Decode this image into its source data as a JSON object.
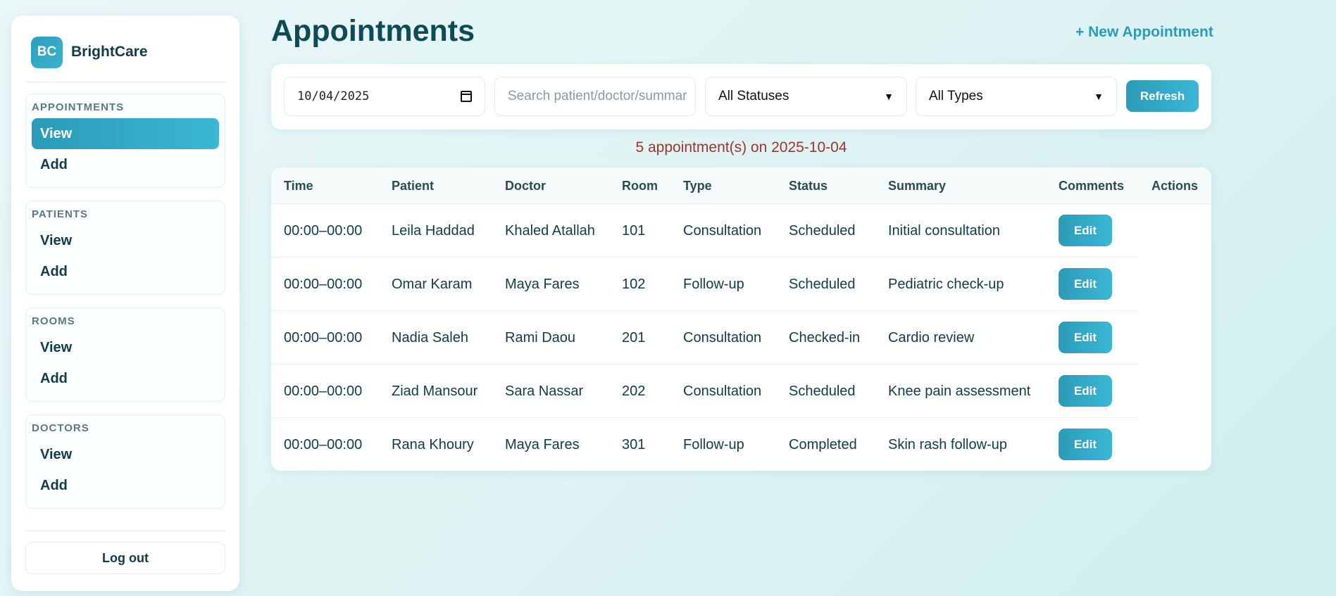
{
  "brand": {
    "logo": "BC",
    "name": "BrightCare"
  },
  "sidebar": {
    "groups": [
      {
        "title": "APPOINTMENTS",
        "items": [
          {
            "label": "View",
            "active": true
          },
          {
            "label": "Add"
          }
        ]
      },
      {
        "title": "PATIENTS",
        "items": [
          {
            "label": "View"
          },
          {
            "label": "Add"
          }
        ]
      },
      {
        "title": "ROOMS",
        "items": [
          {
            "label": "View"
          },
          {
            "label": "Add"
          }
        ]
      },
      {
        "title": "DOCTORS",
        "items": [
          {
            "label": "View"
          },
          {
            "label": "Add"
          }
        ]
      }
    ],
    "logout_label": "Log out"
  },
  "header": {
    "title": "Appointments",
    "new_label": "+ New Appointment"
  },
  "filters": {
    "date_value": "10/04/2025",
    "search_placeholder": "Search patient/doctor/summar",
    "status_value": "All Statuses",
    "type_value": "All Types",
    "refresh_label": "Refresh"
  },
  "summary_text": "5 appointment(s) on 2025-10-04",
  "table": {
    "columns": [
      "Time",
      "Patient",
      "Doctor",
      "Room",
      "Type",
      "Status",
      "Summary",
      "Comments",
      "Actions"
    ],
    "edit_label": "Edit",
    "rows": [
      {
        "time": "00:00–00:00",
        "patient": "Leila Haddad",
        "doctor": "Khaled Atallah",
        "room": "101",
        "type": "Consultation",
        "status": "Scheduled",
        "summary": "Initial consultation"
      },
      {
        "time": "00:00–00:00",
        "patient": "Omar Karam",
        "doctor": "Maya Fares",
        "room": "102",
        "type": "Follow-up",
        "status": "Scheduled",
        "summary": "Pediatric check-up"
      },
      {
        "time": "00:00–00:00",
        "patient": "Nadia Saleh",
        "doctor": "Rami Daou",
        "room": "201",
        "type": "Consultation",
        "status": "Checked-in",
        "summary": "Cardio review"
      },
      {
        "time": "00:00–00:00",
        "patient": "Ziad Mansour",
        "doctor": "Sara Nassar",
        "room": "202",
        "type": "Consultation",
        "status": "Scheduled",
        "summary": "Knee pain assessment"
      },
      {
        "time": "00:00–00:00",
        "patient": "Rana Khoury",
        "doctor": "Maya Fares",
        "room": "301",
        "type": "Follow-up",
        "status": "Completed",
        "summary": "Skin rash follow-up"
      }
    ]
  }
}
